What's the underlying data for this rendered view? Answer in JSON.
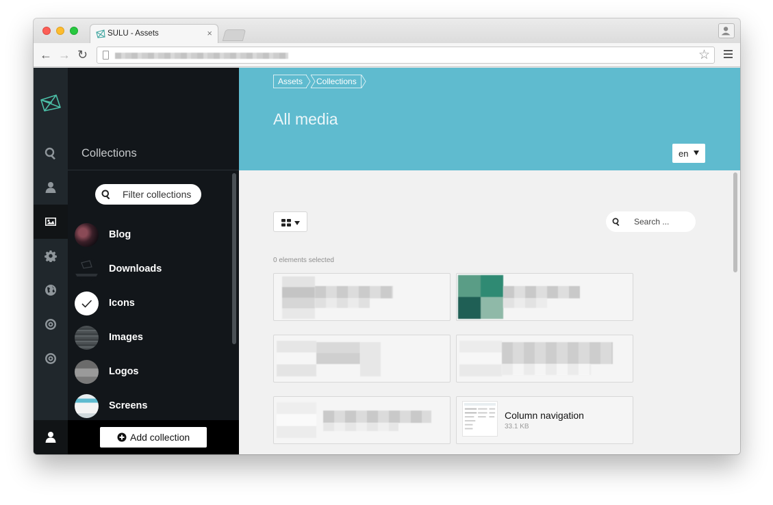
{
  "browser": {
    "tab_title": "SULU - Assets",
    "tab_close": "×",
    "nav_back": "←",
    "nav_forward": "→",
    "nav_reload": "↻",
    "star": "☆"
  },
  "rail": {
    "items": [
      "search-icon",
      "user-icon",
      "image-icon",
      "gear-icon",
      "globe-icon",
      "target-icon",
      "target-icon"
    ],
    "active": "image-icon"
  },
  "collections": {
    "title": "Collections",
    "filter_placeholder": "Filter collections",
    "items": [
      {
        "label": "Blog"
      },
      {
        "label": "Downloads"
      },
      {
        "label": "Icons"
      },
      {
        "label": "Images"
      },
      {
        "label": "Logos"
      },
      {
        "label": "Screens"
      }
    ],
    "add_label": "Add collection"
  },
  "header": {
    "breadcrumb": [
      "Assets",
      "Collections"
    ],
    "title": "All media",
    "language": "en",
    "color": "#5fbbcf"
  },
  "toolbar": {
    "search_placeholder": "Search ...",
    "selected_text": "0 elements selected"
  },
  "media": {
    "visible_card": {
      "title": "Column navigation",
      "size": "33.1 KB"
    }
  }
}
